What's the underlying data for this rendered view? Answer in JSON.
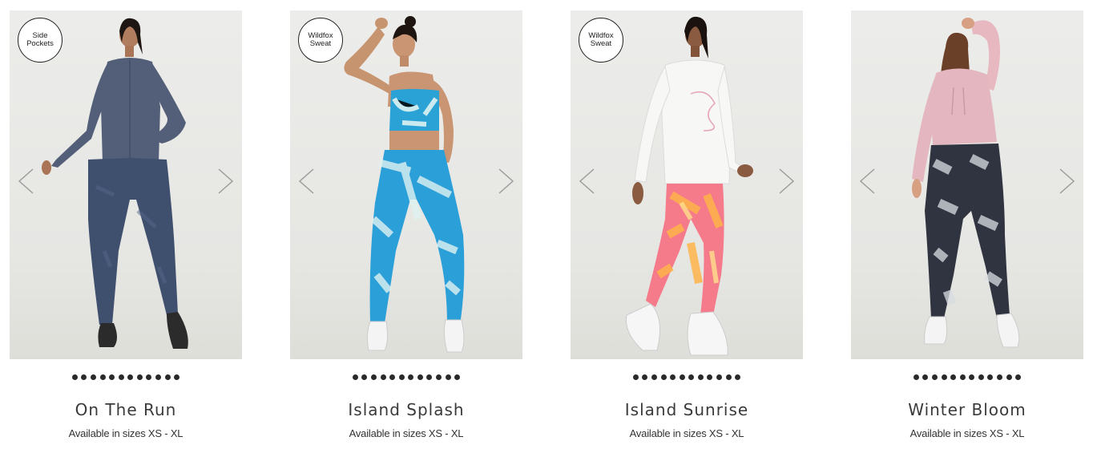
{
  "products": [
    {
      "badge": "Side\nPockets",
      "name": "On The Run",
      "sizes": "Available in sizes XS - XL",
      "image_label": "model wearing slate blue zip jacket and navy printed leggings"
    },
    {
      "badge": "Wildfox\nSweat",
      "name": "Island Splash",
      "sizes": "Available in sizes XS - XL",
      "image_label": "model wearing blue tie-dye sports bra and leggings"
    },
    {
      "badge": "Wildfox\nSweat",
      "name": "Island Sunrise",
      "sizes": "Available in sizes XS - XL",
      "image_label": "model wearing white long sleeve top and pink orange tie-dye leggings"
    },
    {
      "badge": "",
      "name": "Winter Bloom",
      "sizes": "Available in sizes XS - XL",
      "image_label": "model wearing pink cropped hoodie and grey floral leggings"
    }
  ],
  "carousel": {
    "dot_count": 12,
    "prev_icon": "chevron-left-icon",
    "next_icon": "chevron-right-icon"
  },
  "colors": {
    "photo_bg": "#e8e8e5",
    "dot": "#2a2a2a",
    "text": "#333333"
  }
}
